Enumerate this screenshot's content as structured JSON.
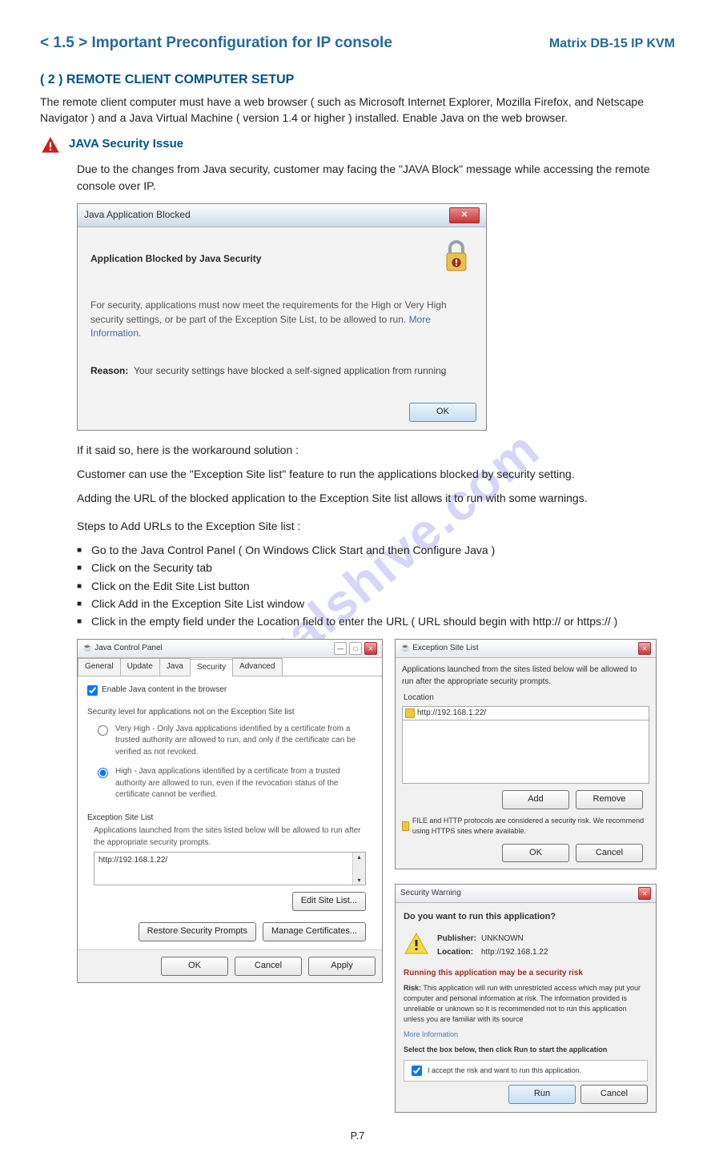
{
  "header": {
    "title": "< 1.5 > Important Preconfiguration for IP console",
    "product": "Matrix  DB-15 IP KVM"
  },
  "subsection": "( 2 ) REMOTE  CLIENT  COMPUTER  SETUP",
  "intro": "The remote client computer must have a web browser ( such as Microsoft Internet Explorer, Mozilla Firefox, and Netscape Navigator ) and a Java Virtual Machine ( version 1.4 or higher ) installed. Enable Java on the web browser.",
  "issue": {
    "title": "JAVA  Security  Issue",
    "text": "Due to the changes from Java security, customer may facing the \"JAVA Block\" message while accessing the remote console over IP."
  },
  "dialog1": {
    "title": "Java Application Blocked",
    "heading": "Application Blocked by Java Security",
    "msg": "For security, applications must now meet the requirements for the High or Very High security settings, or be part of the Exception Site List, to be allowed to run.",
    "more": "More Information.",
    "reason_label": "Reason:",
    "reason": "Your security settings have blocked a self-signed application from running",
    "ok": "OK"
  },
  "workaround": {
    "l1": "If it said so, here is the workaround solution :",
    "l2": "Customer can use the \"Exception Site list\" feature to run the applications blocked by security setting.",
    "l3": "Adding the URL of the blocked application to the Exception Site list allows it to run with some warnings.",
    "steps_head": "Steps to Add URLs to the Exception Site list :",
    "steps": [
      "Go to the Java Control Panel ( On Windows Click Start and then Configure Java )",
      "Click on the Security tab",
      "Click on the Edit Site List button",
      "Click Add in the Exception Site List window",
      "Click in the empty field under the Location field to enter the URL ( URL should begin with http://  or  https:// )"
    ]
  },
  "jcp": {
    "title": "Java Control Panel",
    "tabs": [
      "General",
      "Update",
      "Java",
      "Security",
      "Advanced"
    ],
    "enable": "Enable Java content in the browser",
    "sec_label": "Security level for applications not on the Exception Site list",
    "vhigh": "Very High - Only Java applications identified by a certificate from a trusted authority are allowed to run, and only if the certificate can be verified as not revoked.",
    "high": "High - Java applications identified by a certificate from a trusted authority are allowed to run, even if the revocation status of the certificate cannot be verified.",
    "esl_head": "Exception Site List",
    "esl_desc": "Applications launched from the sites listed below will be allowed to run after the appropriate security prompts.",
    "esl_url": "http://192.168.1.22/",
    "edit_btn": "Edit Site List...",
    "restore_btn": "Restore Security Prompts",
    "manage_btn": "Manage Certificates...",
    "ok": "OK",
    "cancel": "Cancel",
    "apply": "Apply"
  },
  "esl_dlg": {
    "title": "Exception Site List",
    "msg": "Applications launched from the sites listed below will be allowed to run after the appropriate security prompts.",
    "loc_label": "Location",
    "url": "http://192.168.1.22/",
    "warn": "FILE and HTTP protocols are considered a security risk.  We recommend using HTTPS sites where available.",
    "add": "Add",
    "remove": "Remove",
    "ok": "OK",
    "cancel": "Cancel"
  },
  "secwarn": {
    "title": "Security Warning",
    "q": "Do you want to run this application?",
    "pub_l": "Publisher:",
    "pub": "UNKNOWN",
    "loc_l": "Location:",
    "loc": "http://192.168.1.22",
    "risk_head": "Running this application may be a security risk",
    "risk_l": "Risk:",
    "risk": "This application will run with unrestricted access which may put your computer and personal information at risk. The information provided is unreliable or unknown so it is recommended not to run this application unless you are familiar with its source",
    "more": "More Information",
    "select": "Select the box below, then click Run to start the application",
    "accept": "I accept the risk and want to run this application.",
    "run": "Run",
    "cancel": "Cancel"
  },
  "watermark": "manualshive.com",
  "page": "P.7"
}
